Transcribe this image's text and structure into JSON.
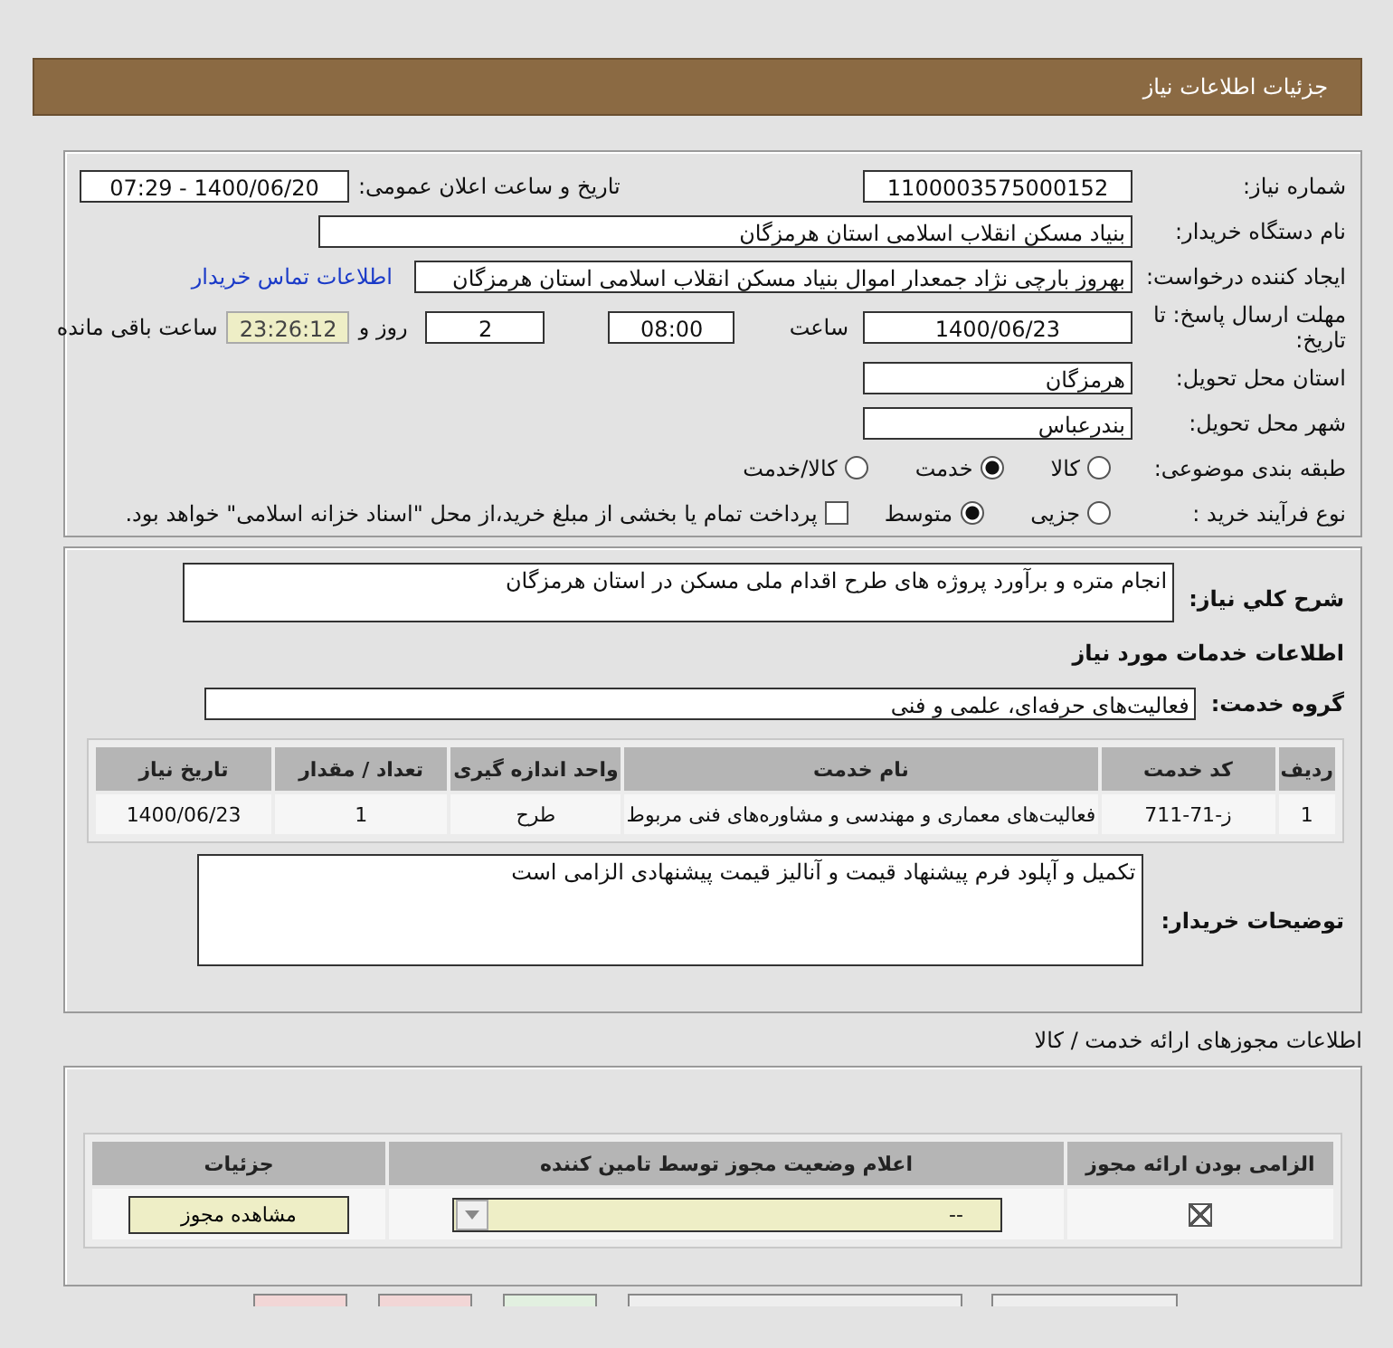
{
  "header": {
    "title": "جزئیات اطلاعات نیاز"
  },
  "details": {
    "need_number": {
      "label": "شماره نیاز:",
      "value": "1100003575000152"
    },
    "announce": {
      "label": "تاریخ و ساعت اعلان عمومی:",
      "value": "1400/06/20 - 07:29"
    },
    "buyer_org": {
      "label": "نام دستگاه خریدار:",
      "value": "بنیاد مسکن انقلاب اسلامی استان هرمزگان"
    },
    "requester": {
      "label": "ایجاد کننده درخواست:",
      "value": "بهروز  بارچی نژاد جمعدار اموال بنیاد مسکن انقلاب اسلامی استان هرمزگان",
      "link": "اطلاعات تماس خریدار"
    },
    "deadline": {
      "label": "مهلت ارسال پاسخ: تا تاریخ:",
      "date": "1400/06/23",
      "time_label": "ساعت",
      "time": "08:00",
      "days": "2",
      "days_label": "روز و",
      "remaining": "23:26:12",
      "remaining_label": "ساعت باقی مانده"
    },
    "province": {
      "label": "استان محل تحویل:",
      "value": "هرمزگان"
    },
    "city": {
      "label": "شهر محل تحویل:",
      "value": "بندرعباس"
    },
    "category": {
      "label": "طبقه بندی موضوعی:",
      "options": [
        {
          "label": "کالا",
          "selected": false
        },
        {
          "label": "خدمت",
          "selected": true
        },
        {
          "label": "کالا/خدمت",
          "selected": false
        }
      ]
    },
    "process": {
      "label": "نوع فرآیند خرید :",
      "options": [
        {
          "label": "جزیی",
          "selected": false
        },
        {
          "label": "متوسط",
          "selected": true
        }
      ],
      "treasury": {
        "label": "پرداخت تمام یا بخشی از مبلغ خرید،از محل \"اسناد خزانه اسلامی\" خواهد بود.",
        "checked": false
      }
    }
  },
  "need": {
    "description_label": "شرح کلي نیاز:",
    "description": "انجام متره و برآورد پروژه های طرح اقدام ملی مسکن در استان هرمزگان",
    "services_heading": "اطلاعات خدمات مورد نیاز",
    "group_label": "گروه خدمت:",
    "group": "فعالیت‌های حرفه‌ای، علمی و فنی",
    "table": {
      "columns": [
        "ردیف",
        "کد خدمت",
        "نام خدمت",
        "واحد اندازه گیری",
        "تعداد / مقدار",
        "تاریخ نیاز"
      ],
      "rows": [
        [
          "1",
          "ز-71-711",
          "فعالیت‌های معماری و مهندسی و مشاوره‌های فنی مربوط",
          "طرح",
          "1",
          "1400/06/23"
        ]
      ]
    },
    "notes_label": "توضیحات خریدار:",
    "notes": "تکمیل و آپلود فرم پیشنهاد قیمت و آنالیز قیمت پیشنهادی الزامی است"
  },
  "permits": {
    "heading": "اطلاعات مجوزهای ارائه خدمت / کالا",
    "columns": [
      "الزامی بودن ارائه مجوز",
      "اعلام وضعیت مجوز توسط تامین کننده",
      "جزئیات"
    ],
    "rows": [
      {
        "required": true,
        "status": "--",
        "button": "مشاهده مجوز"
      }
    ]
  },
  "bottom_buttons": [
    {
      "color": "#f2d6d6"
    },
    {
      "color": "#f2d6d6"
    },
    {
      "color": "#e2f0e0"
    },
    {
      "color": "#eeeeee"
    },
    {
      "color": "#eeeeee"
    }
  ]
}
